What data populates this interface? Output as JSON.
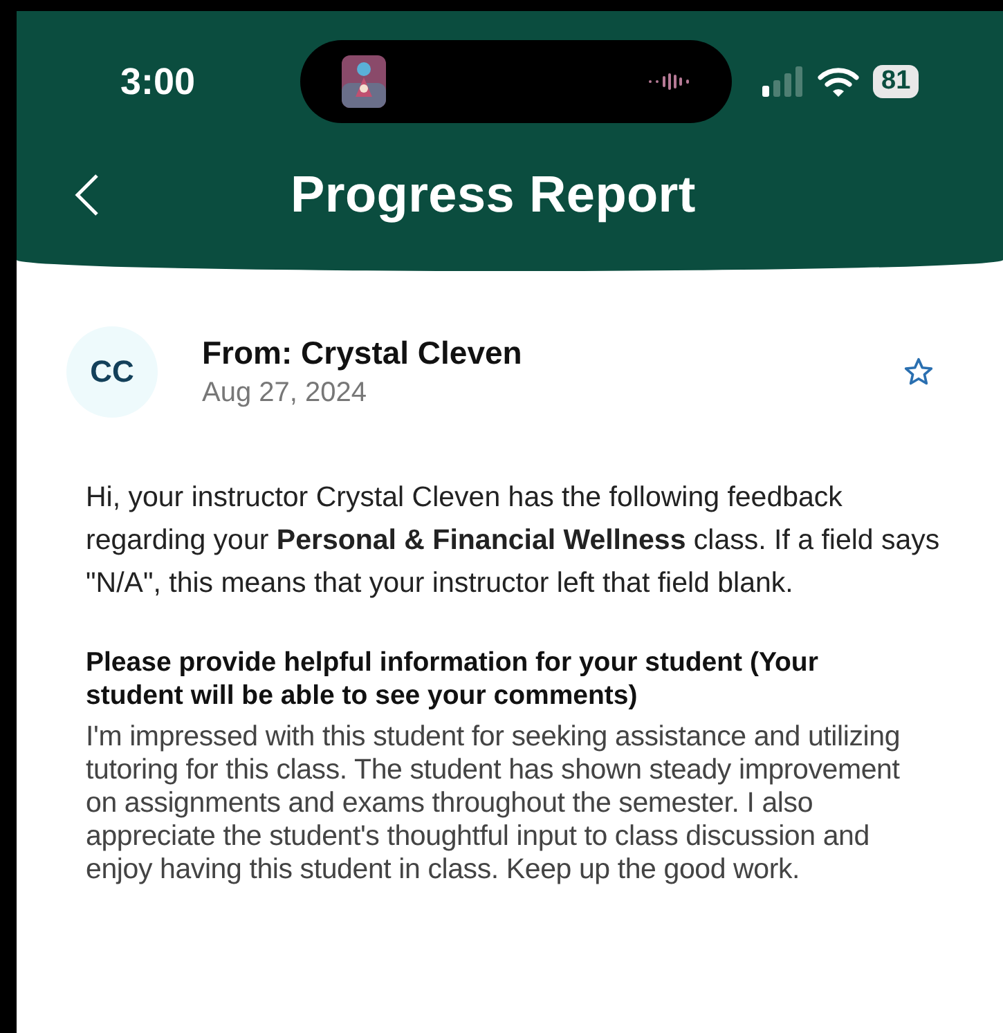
{
  "status_bar": {
    "time": "3:00",
    "battery": "81"
  },
  "header": {
    "title": "Progress Report"
  },
  "message": {
    "avatar": "CC",
    "from": "From: Crystal Cleven",
    "date": "Aug 27, 2024",
    "starred": false,
    "intro": "Hi, your instructor Crystal Cleven has the following feedback regarding your **Personal & Financial Wellness** class. If a field says \"N/A\", this means that your instructor left that field blank.",
    "fields": [
      {
        "question": "Please provide helpful information for your student (Your student will be able to see your comments)",
        "answer": "I'm impressed with this student for seeking assistance and utilizing tutoring for this class. The student has shown steady improvement on assignments and exams throughout the semester. I also appreciate the student's thoughtful input to class discussion and enjoy having this student in class. Keep up the good work."
      }
    ]
  }
}
